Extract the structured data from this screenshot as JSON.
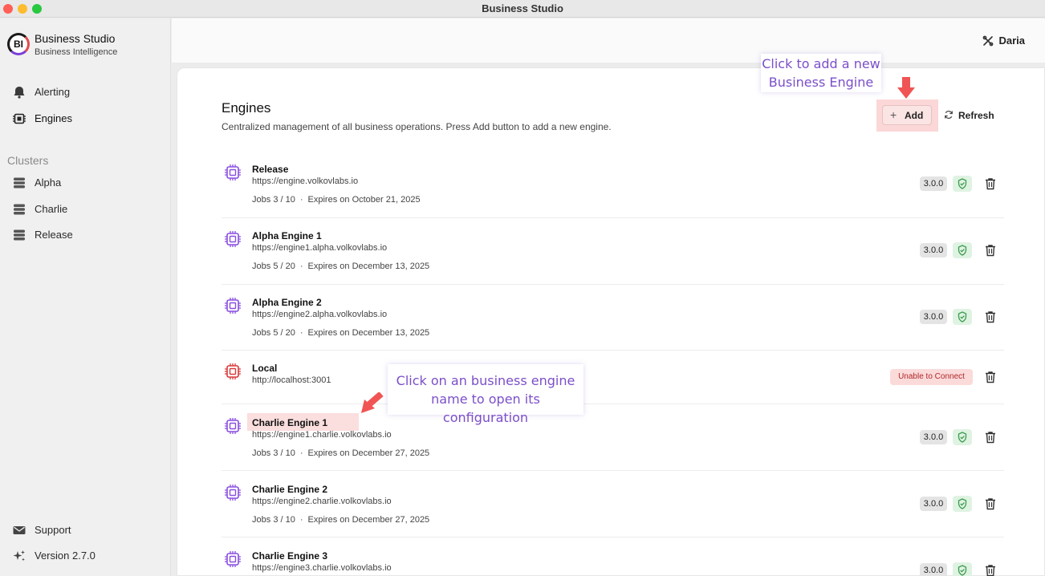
{
  "window": {
    "title": "Business Studio"
  },
  "brand": {
    "logo": "BI",
    "name": "Business Studio",
    "subtitle": "Business Intelligence"
  },
  "sidebar": {
    "nav": [
      {
        "label": "Alerting",
        "icon": "bell-icon"
      },
      {
        "label": "Engines",
        "icon": "chip-icon"
      }
    ],
    "clusters_title": "Clusters",
    "clusters": [
      {
        "label": "Alpha",
        "icon": "server-icon"
      },
      {
        "label": "Charlie",
        "icon": "server-icon"
      },
      {
        "label": "Release",
        "icon": "server-icon"
      }
    ],
    "footer": [
      {
        "label": "Support",
        "icon": "mail-icon"
      },
      {
        "label": "Version 2.7.0",
        "icon": "sparkle-icon"
      }
    ]
  },
  "header": {
    "user": "Daria"
  },
  "main": {
    "title": "Engines",
    "description": "Centralized management of all business operations. Press Add button to add a new engine.",
    "add_label": "Add",
    "refresh_label": "Refresh",
    "jobs_prefix": "Jobs",
    "expires_prefix": "Expires on",
    "engines": [
      {
        "name": "Release",
        "url": "https://engine.volkovlabs.io",
        "jobs": "3 / 10",
        "expires": "October 21, 2025",
        "version": "3.0.0",
        "status": "ok"
      },
      {
        "name": "Alpha Engine 1",
        "url": "https://engine1.alpha.volkovlabs.io",
        "jobs": "5 / 20",
        "expires": "December 13, 2025",
        "version": "3.0.0",
        "status": "ok"
      },
      {
        "name": "Alpha Engine 2",
        "url": "https://engine2.alpha.volkovlabs.io",
        "jobs": "5 / 20",
        "expires": "December 13, 2025",
        "version": "3.0.0",
        "status": "ok"
      },
      {
        "name": "Local",
        "url": "http://localhost:3001",
        "status": "error",
        "error_label": "Unable to Connect"
      },
      {
        "name": "Charlie Engine 1",
        "url": "https://engine1.charlie.volkovlabs.io",
        "jobs": "3 / 10",
        "expires": "December 27, 2025",
        "version": "3.0.0",
        "status": "ok"
      },
      {
        "name": "Charlie Engine 2",
        "url": "https://engine2.charlie.volkovlabs.io",
        "jobs": "3 / 10",
        "expires": "December 27, 2025",
        "version": "3.0.0",
        "status": "ok"
      },
      {
        "name": "Charlie Engine 3",
        "url": "https://engine3.charlie.volkovlabs.io",
        "version": "3.0.0",
        "status": "ok"
      }
    ]
  },
  "annotations": {
    "add_callout": [
      "Click to add a new",
      "Business Engine"
    ],
    "name_callout": [
      "Click on an business engine",
      "name to open its configuration"
    ]
  },
  "colors": {
    "accent_purple": "#8a4fe0",
    "error_red": "#d83a3a",
    "highlight_pink": "#fbd7d7",
    "arrow_red": "#f05454"
  }
}
